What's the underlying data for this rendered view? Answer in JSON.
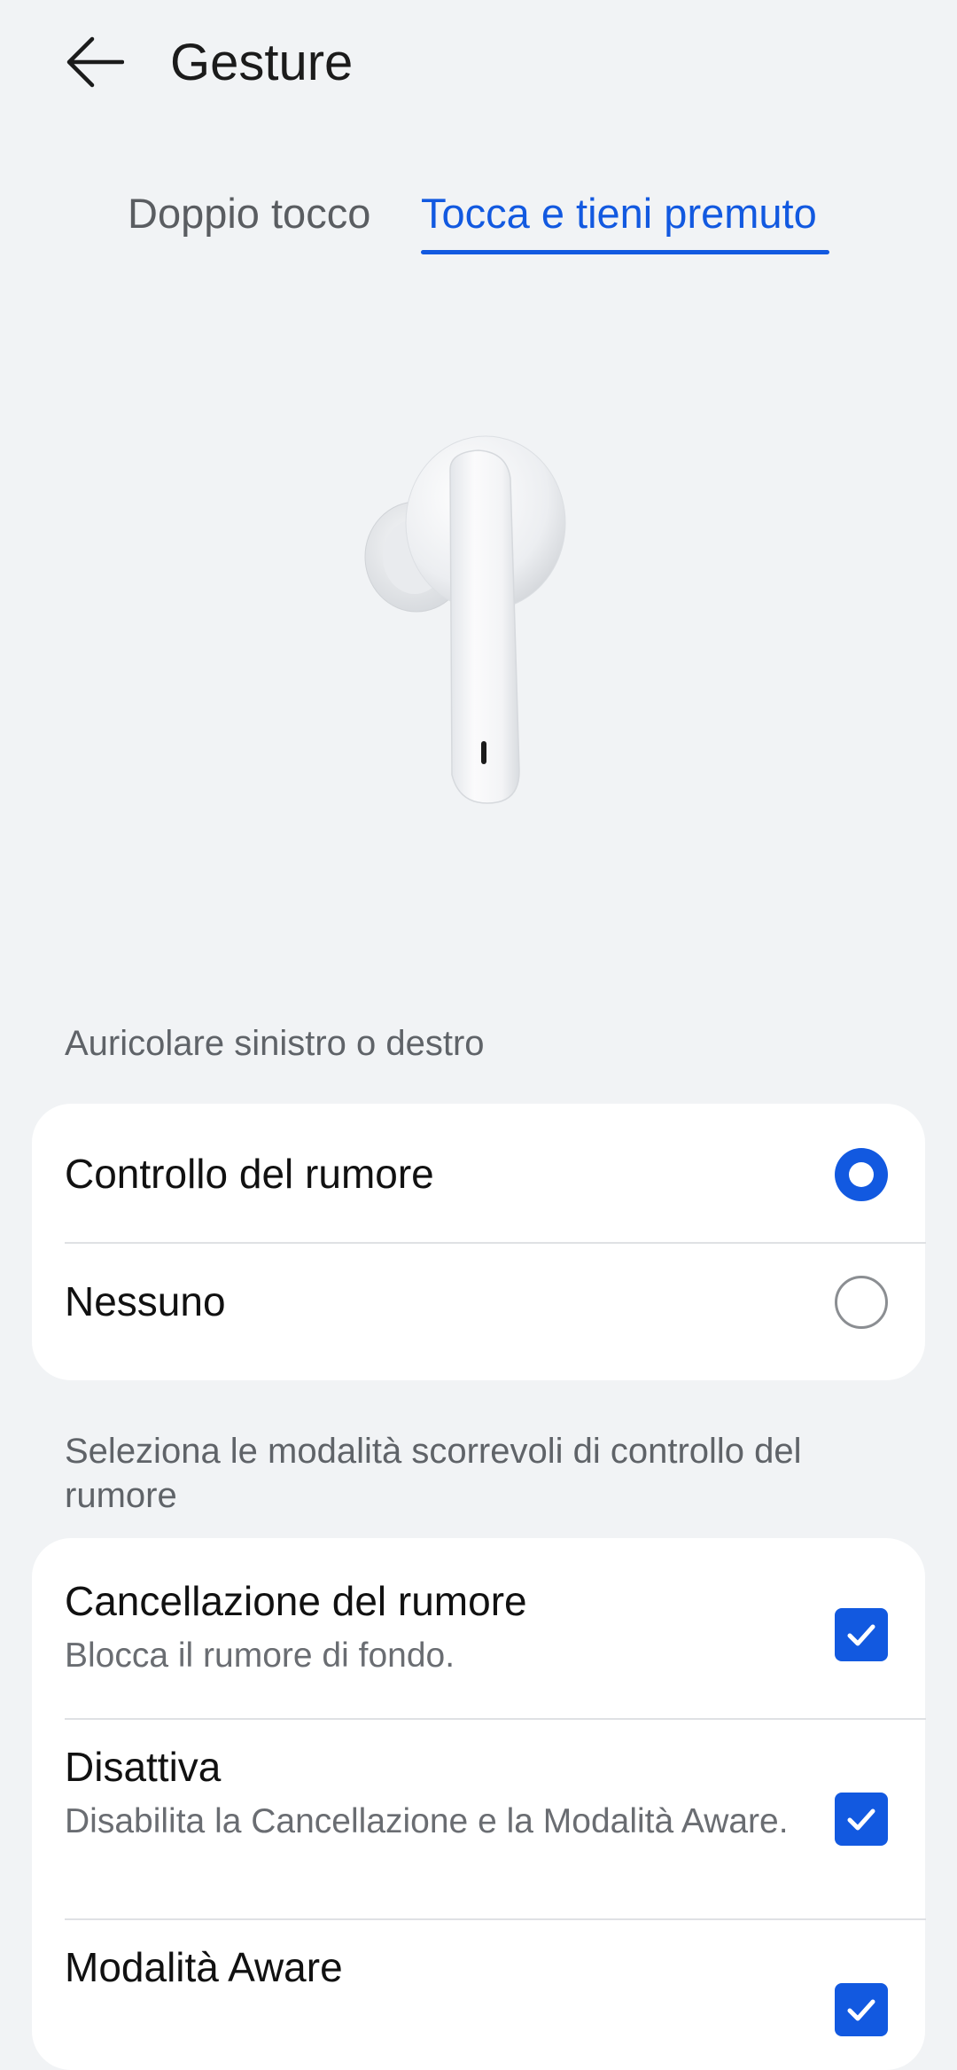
{
  "header": {
    "title": "Gesture",
    "back_icon": "arrow-left-icon"
  },
  "tabs": [
    {
      "label": "Doppio tocco",
      "active": false
    },
    {
      "label": "Tocca e tieni premuto",
      "active": true
    }
  ],
  "colors": {
    "accent": "#1259e0",
    "background": "#f1f3f5",
    "card": "#ffffff",
    "secondary_text": "#5f6368"
  },
  "illustration": {
    "icon": "earbud-illustration"
  },
  "sections": {
    "ear_label": "Auricolare sinistro o destro",
    "ear_options": [
      {
        "label": "Controllo del rumore",
        "selected": true
      },
      {
        "label": "Nessuno",
        "selected": false
      }
    ],
    "modes_label": "Seleziona le modalità scorrevoli di controllo del rumore",
    "modes": [
      {
        "title": "Cancellazione del rumore",
        "subtitle": "Blocca il rumore di fondo.",
        "checked": true
      },
      {
        "title": "Disattiva",
        "subtitle": "Disabilita la Cancellazione e la Modalità Aware.",
        "checked": true
      },
      {
        "title": "Modalità Aware",
        "subtitle": "",
        "checked": true
      }
    ]
  }
}
